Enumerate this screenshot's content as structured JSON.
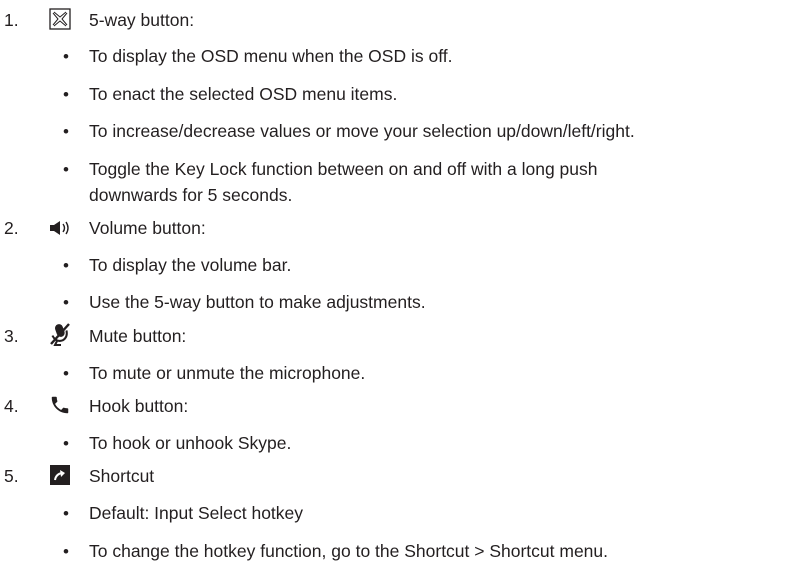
{
  "items": [
    {
      "number": "1.",
      "icon": "5-way-button-icon",
      "label": "5-way button:",
      "bullets": [
        "To display the OSD menu when the OSD is off.",
        "To enact the selected OSD menu items.",
        "To increase/decrease values or move your selection up/down/left/right.",
        "Toggle the Key Lock function between on and off with a long push",
        "downwards for 5 seconds."
      ]
    },
    {
      "number": "2.",
      "icon": "volume-icon",
      "label": "Volume button:",
      "bullets": [
        "To display the volume bar.",
        "Use the 5-way button to make adjustments."
      ]
    },
    {
      "number": "3.",
      "icon": "mute-microphone-icon",
      "label": "Mute button:",
      "bullets": [
        "To mute or unmute the microphone."
      ]
    },
    {
      "number": "4.",
      "icon": "phone-hook-icon",
      "label": "Hook button:",
      "bullets": [
        "To hook or unhook Skype."
      ]
    },
    {
      "number": "5.",
      "icon": "shortcut-arrow-icon",
      "label": "Shortcut",
      "bullets": [
        "Default: Input Select hotkey",
        "To change the hotkey function, go to the Shortcut > Shortcut menu."
      ]
    }
  ]
}
